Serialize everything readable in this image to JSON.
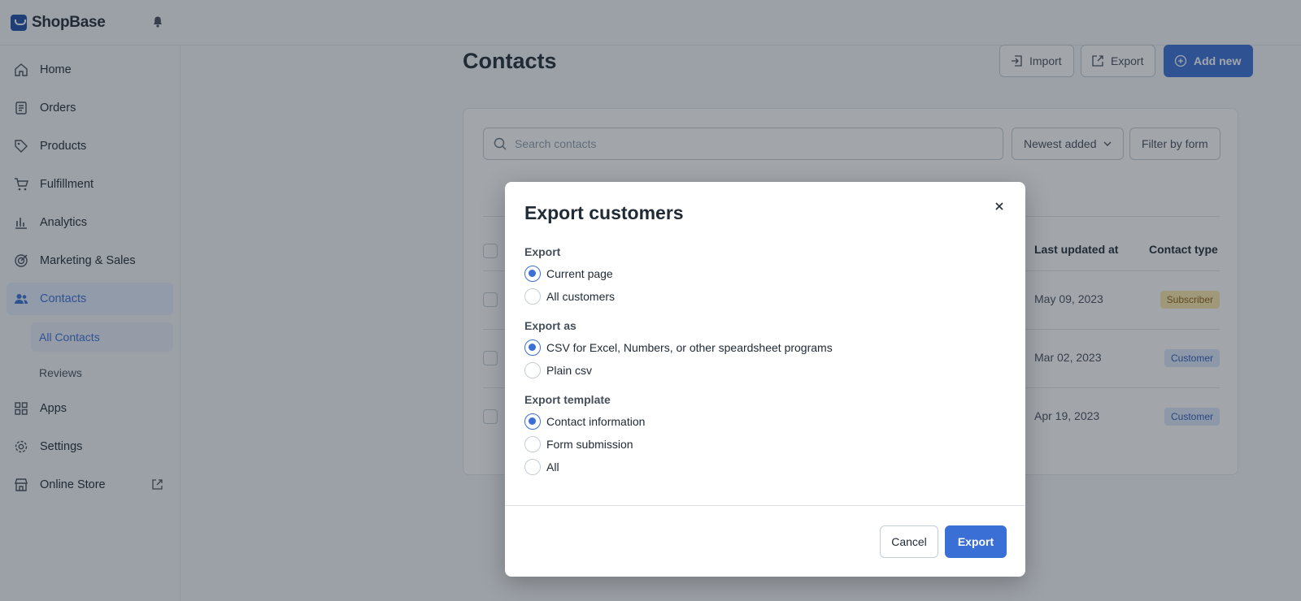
{
  "app": {
    "brand": "ShopBase"
  },
  "sidebar": {
    "items": [
      {
        "label": "Home",
        "icon": "home-icon"
      },
      {
        "label": "Orders",
        "icon": "orders-icon"
      },
      {
        "label": "Products",
        "icon": "tag-icon"
      },
      {
        "label": "Fulfillment",
        "icon": "cart-icon"
      },
      {
        "label": "Analytics",
        "icon": "bar-chart-icon"
      },
      {
        "label": "Marketing & Sales",
        "icon": "target-icon"
      },
      {
        "label": "Contacts",
        "icon": "users-icon",
        "active": true
      },
      {
        "label": "Apps",
        "icon": "grid-icon"
      },
      {
        "label": "Settings",
        "icon": "gear-icon"
      },
      {
        "label": "Online Store",
        "icon": "store-icon"
      }
    ],
    "sub_items": [
      {
        "label": "All Contacts",
        "active": true
      },
      {
        "label": "Reviews"
      }
    ]
  },
  "page": {
    "title": "Contacts",
    "import_label": "Import",
    "export_label": "Export",
    "add_new_label": "Add new"
  },
  "toolbar": {
    "search_placeholder": "Search contacts",
    "sort_label": "Newest added",
    "filter_label": "Filter by form"
  },
  "table": {
    "headers": {
      "last_updated": "Last updated at",
      "contact_type": "Contact type"
    },
    "rows": [
      {
        "last_updated": "May 09, 2023",
        "contact_type": "Subscriber"
      },
      {
        "last_updated": "Mar 02, 2023",
        "contact_type": "Customer"
      },
      {
        "last_updated": "Apr 19, 2023",
        "contact_type": "Customer"
      }
    ]
  },
  "modal": {
    "title": "Export customers",
    "export_section": {
      "label": "Export",
      "options": [
        "Current page",
        "All customers"
      ],
      "selected": "Current page"
    },
    "export_as_section": {
      "label": "Export as",
      "options": [
        "CSV for Excel, Numbers, or other speardsheet programs",
        "Plain csv"
      ],
      "selected": "CSV for Excel, Numbers, or other speardsheet programs"
    },
    "template_section": {
      "label": "Export template",
      "options": [
        "Contact information",
        "Form submission",
        "All"
      ],
      "selected": "Contact information"
    },
    "cancel_label": "Cancel",
    "export_label": "Export"
  },
  "colors": {
    "accent": "#3a6fd6",
    "subscriber_badge": "#fce9a9",
    "customer_badge": "#dbe8fb"
  }
}
